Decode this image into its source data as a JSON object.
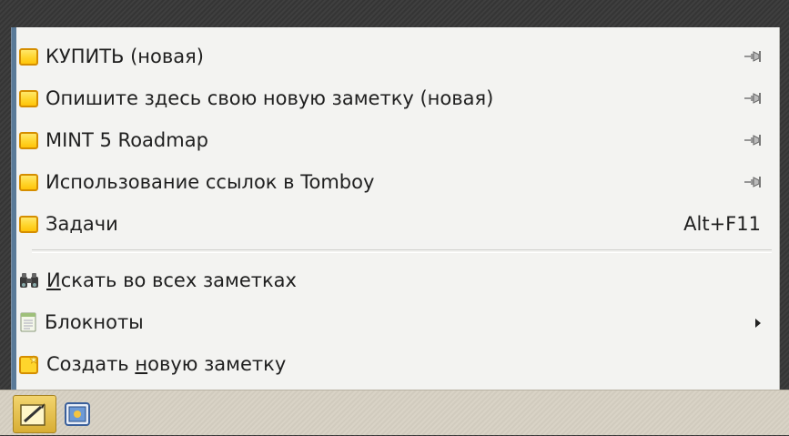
{
  "menu": {
    "notes": [
      {
        "title": "КУПИТЬ (новая)",
        "pinned": true
      },
      {
        "title": "Опишите здесь свою новую заметку (новая)",
        "pinned": true
      },
      {
        "title": "MINT 5 Roadmap",
        "pinned": true
      },
      {
        "title": "Использование ссылок в Tomboy",
        "pinned": true
      },
      {
        "title": "Задачи",
        "pinned": false,
        "shortcut": "Alt+F11"
      }
    ],
    "actions": {
      "search_all": {
        "mnemonic": "И",
        "rest": "скать во всех заметках"
      },
      "notebooks": {
        "label": "Блокноты"
      },
      "create_note": {
        "before": "Создать ",
        "mnemonic": "н",
        "after": "овую заметку"
      }
    }
  },
  "icons": {
    "note": "note-icon",
    "pin": "pin-icon",
    "search": "binoculars-icon",
    "notebooks": "notebook-icon",
    "new_note": "new-note-icon",
    "tomboy_applet": "tomboy-icon",
    "screenshot_applet": "screenshot-icon"
  },
  "colors": {
    "menu_bg": "#f3f3f1",
    "menu_accent": "#5a7a98",
    "note_yellow": "#ffd52c",
    "note_border": "#d58e00"
  }
}
